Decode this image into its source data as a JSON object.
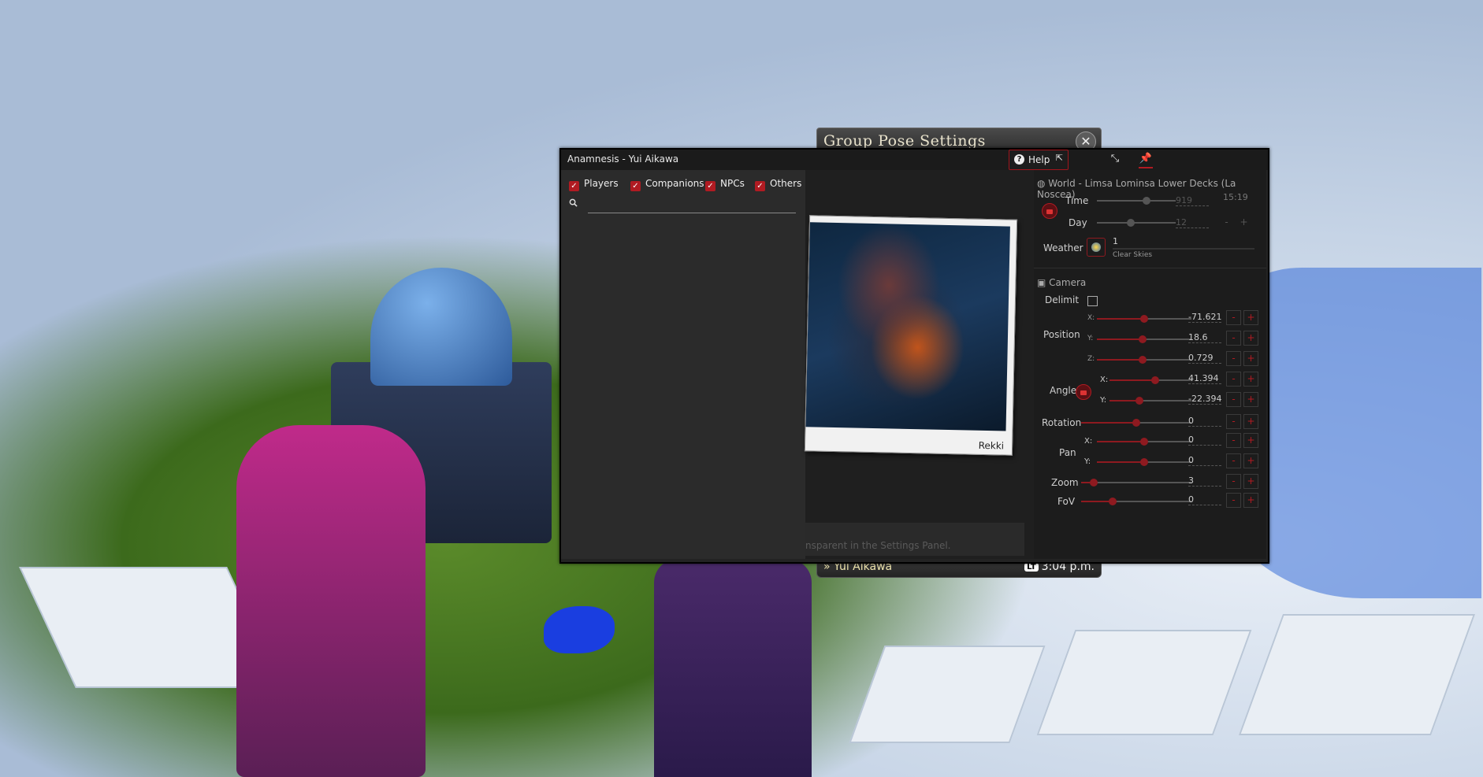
{
  "game": {
    "group_pose_title": "Group Pose Settings",
    "status_player_name": "Yui Aikawa",
    "status_time_badge": "LT",
    "status_time": "3:04 p.m."
  },
  "window": {
    "title": "Anamnesis  -  Yui Aikawa",
    "help_label": "Help"
  },
  "filters": {
    "players": "Players",
    "companions": "Companions",
    "npcs": "NPCs",
    "others": "Others"
  },
  "center": {
    "photo_caption": "Rekki",
    "note_text": "nsparent in the Settings Panel."
  },
  "world": {
    "header": "World  -  Limsa Lominsa Lower Decks (La Noscea)",
    "time_label": "Time",
    "time_value": "919",
    "time_display": "15:19",
    "day_label": "Day",
    "day_value": "12",
    "weather_label": "Weather",
    "weather_value": "1",
    "weather_name": "Clear Skies"
  },
  "camera": {
    "header": "Camera",
    "delimit_label": "Delimit",
    "position_label": "Position",
    "angle_label": "Angle",
    "rotation_label": "Rotation",
    "pan_label": "Pan",
    "zoom_label": "Zoom",
    "fov_label": "FoV",
    "axis_x": "X:",
    "axis_y": "Y:",
    "axis_z": "Z:",
    "pos_x": "-71.621",
    "pos_y": "18.6",
    "pos_z": "0.729",
    "angle_x": "41.394",
    "angle_y": "-22.394",
    "rotation": "0",
    "pan_x": "0",
    "pan_y": "0",
    "zoom": "3",
    "fov": "0",
    "minus": "-",
    "plus": "+"
  }
}
